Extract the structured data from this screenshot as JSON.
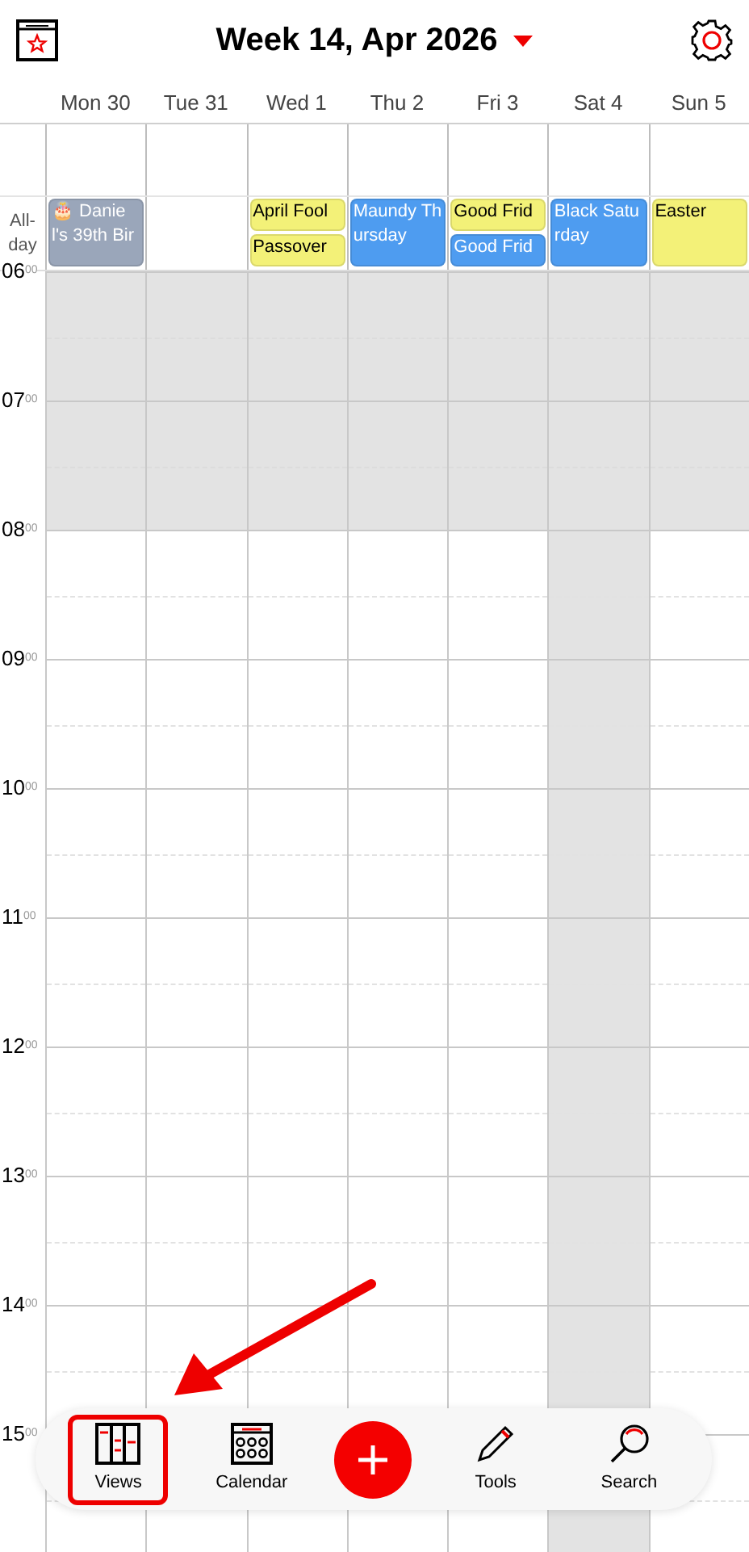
{
  "header": {
    "title": "Week 14, Apr 2026"
  },
  "days": [
    {
      "label": "Mon 30",
      "shaded": false,
      "events": [
        {
          "text": "🎂 Daniel's 39th Bir",
          "color": "#9aa6ba"
        }
      ]
    },
    {
      "label": "Tue 31",
      "shaded": false
    },
    {
      "label": "Wed 1",
      "shaded": false,
      "events": [
        {
          "text": "April Fool",
          "color": "#f3f178"
        },
        {
          "text": "Passover",
          "color": "#f3f178"
        }
      ]
    },
    {
      "label": "Thu 2",
      "shaded": false,
      "events": [
        {
          "text": "Maundy Thursday",
          "color": "#4e9cf0"
        }
      ]
    },
    {
      "label": "Fri 3",
      "shaded": false,
      "events": [
        {
          "text": "Good Frid",
          "color": "#f3f178"
        },
        {
          "text": "Good Frid",
          "color": "#4e9cf0"
        }
      ]
    },
    {
      "label": "Sat 4",
      "shaded": true,
      "events": [
        {
          "text": "Black Saturday",
          "color": "#4e9cf0"
        }
      ]
    },
    {
      "label": "Sun 5",
      "shaded": false,
      "events": [
        {
          "text": "Easter",
          "color": "#f3f178"
        }
      ]
    }
  ],
  "allday_label": "All-day",
  "hours": [
    {
      "label": "06$^{00}$",
      "off_hours": true
    },
    {
      "label": "07$^{00}$",
      "off_hours": true
    },
    {
      "label": "08$^{00}$",
      "off_hours": false
    },
    {
      "label": "09$^{00}$",
      "off_hours": false
    },
    {
      "label": "10$^{00}$",
      "off_hours": false
    },
    {
      "label": "11$^{00}$",
      "off_hours": false
    },
    {
      "label": "12$^{00}$",
      "off_hours": false
    },
    {
      "label": "13$^{00}$",
      "off_hours": false
    },
    {
      "label": "14$^{00}$",
      "off_hours": false
    },
    {
      "label": "15$^{00}$",
      "off_hours": false
    }
  ],
  "toolbar": [
    {
      "kind": "views",
      "label": "Views",
      "highlighted": true
    },
    {
      "kind": "calendar",
      "label": "Calendar",
      "highlighted": false
    },
    {
      "kind": "add"
    },
    {
      "kind": "tools",
      "label": "Tools",
      "highlighted": false
    },
    {
      "kind": "search",
      "label": "Search",
      "highlighted": false
    }
  ]
}
